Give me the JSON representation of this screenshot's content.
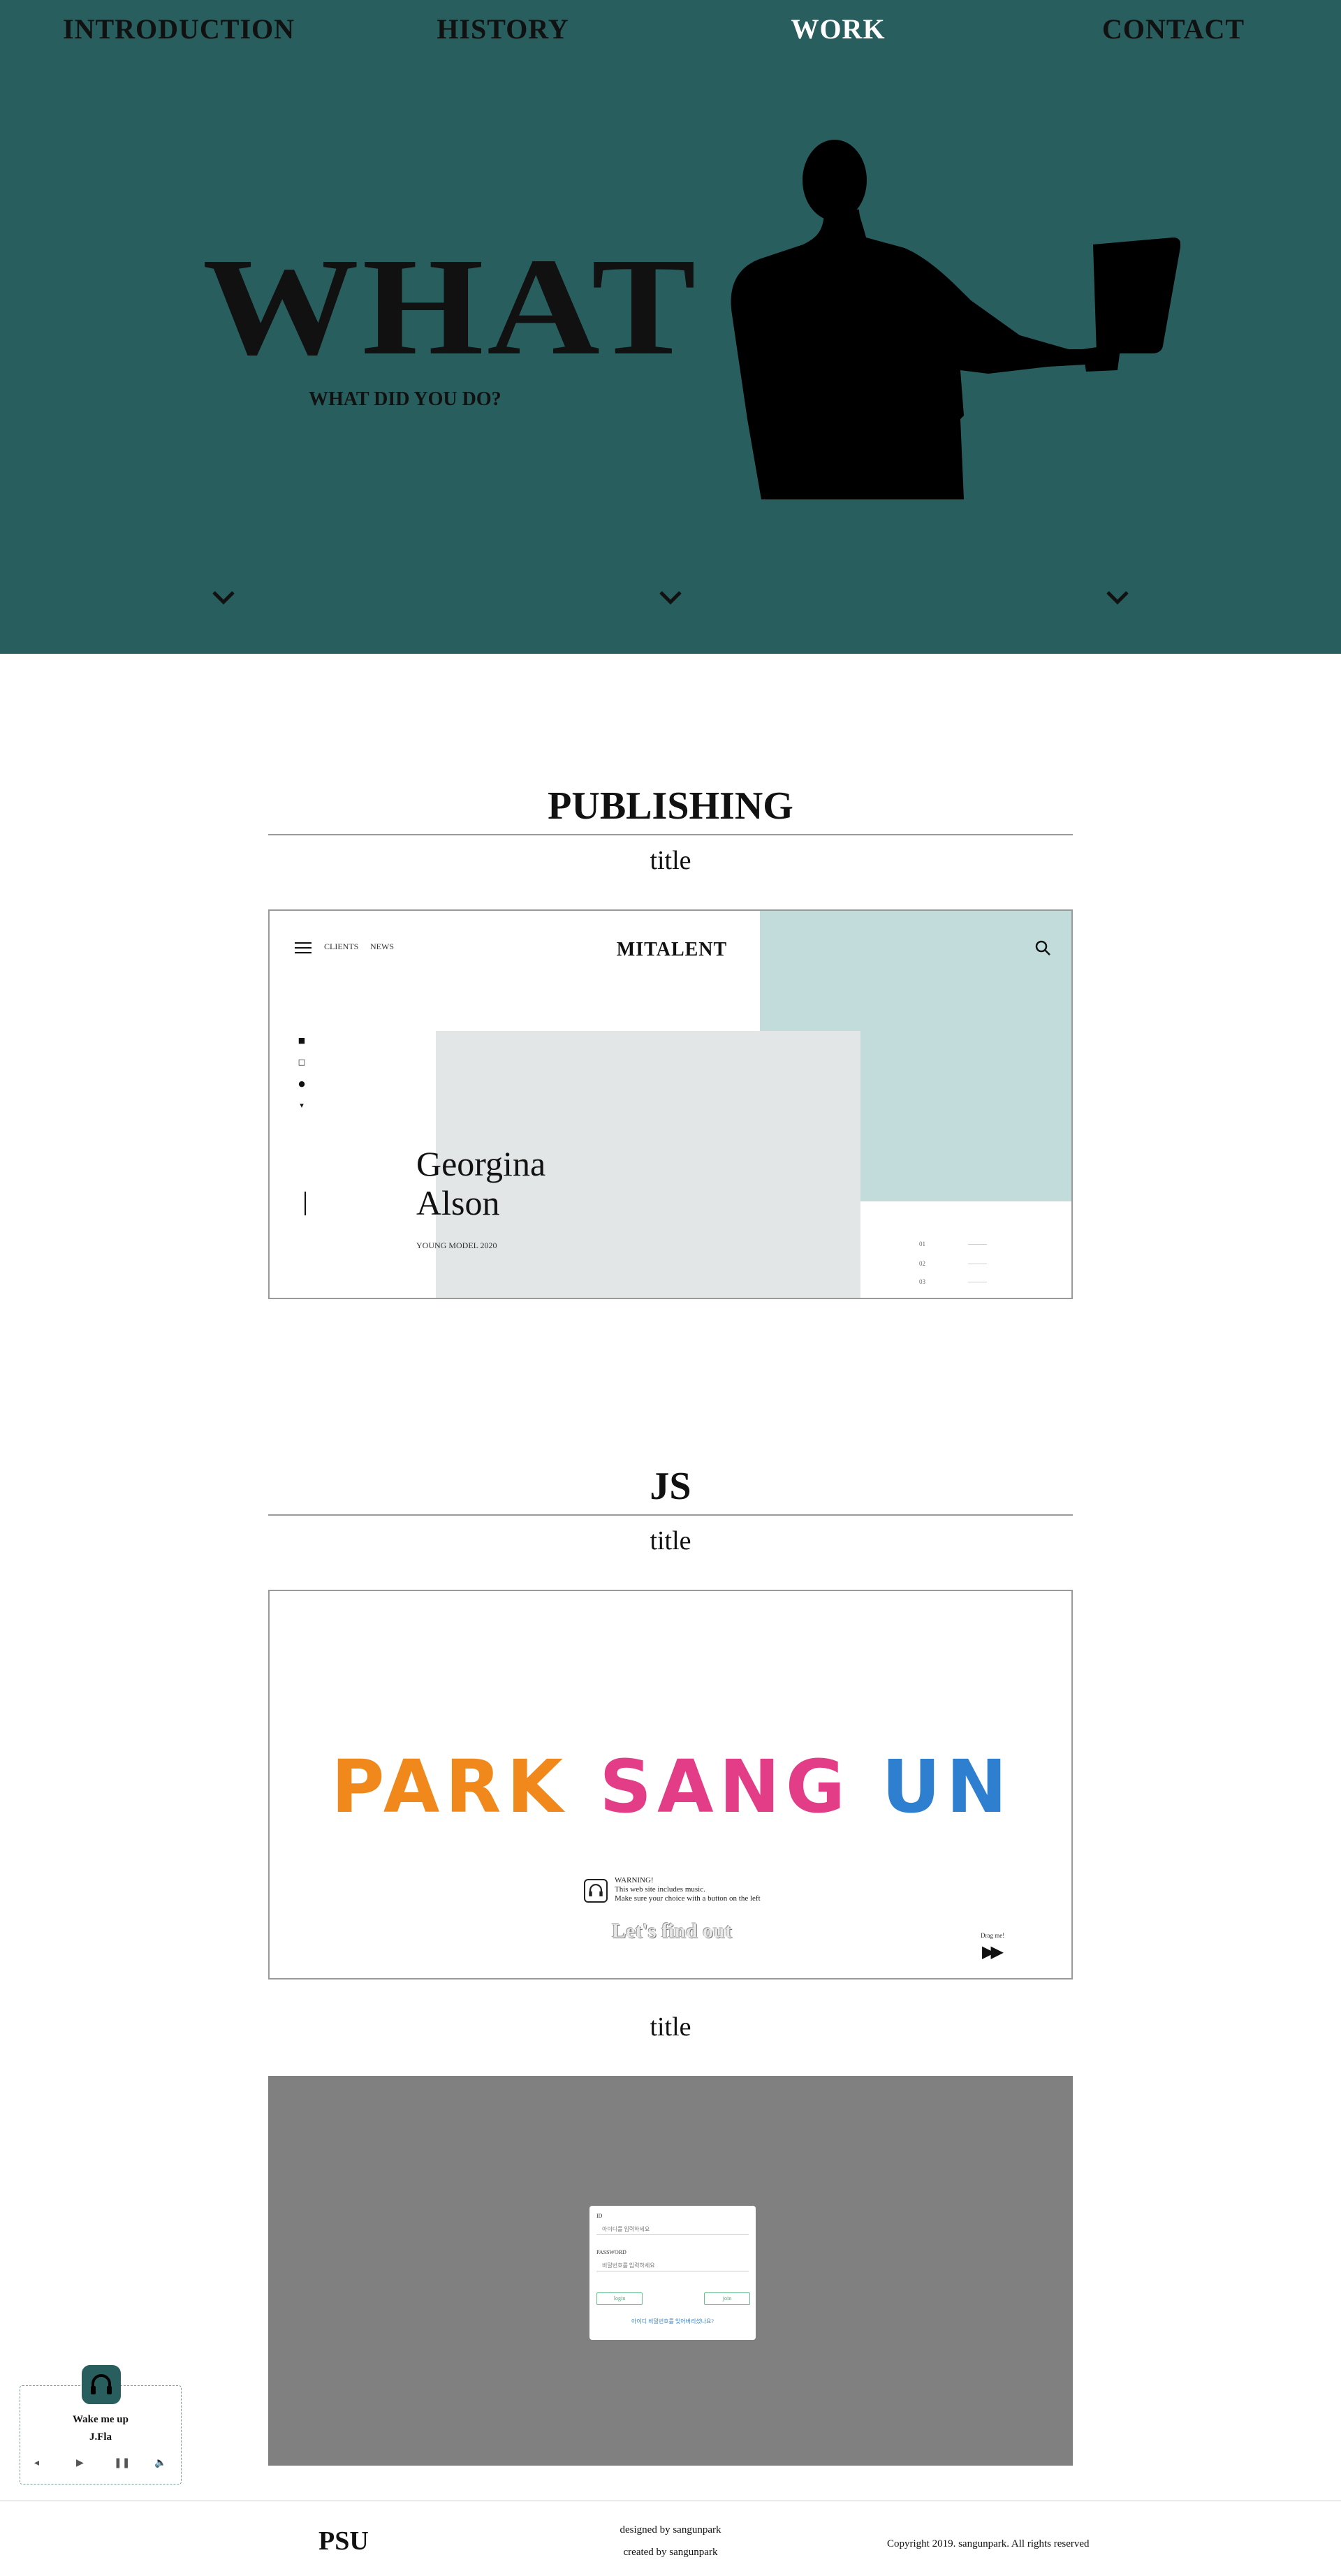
{
  "nav": {
    "items": [
      {
        "label": "INTRODUCTION",
        "active": false
      },
      {
        "label": "HISTORY",
        "active": false
      },
      {
        "label": "WORK",
        "active": true
      },
      {
        "label": "CONTACT",
        "active": false
      }
    ]
  },
  "hero": {
    "title": "WHAT",
    "subtitle": "WHAT DID YOU DO?",
    "background": "#295e5f"
  },
  "sections": {
    "publishing": {
      "heading": "PUBLISHING",
      "item_title": "title",
      "preview": {
        "links": [
          "CLIENTS",
          "NEWS"
        ],
        "logo": "MITALENT",
        "name_line1": "Georgina",
        "name_line2": "Alson",
        "role": "YOUNG MODEL 2020",
        "numbers": [
          "01",
          "02",
          "03"
        ],
        "dashes": [
          "———",
          "———",
          "———"
        ],
        "social_icons": [
          "facebook-icon",
          "instagram-icon",
          "youtube-icon",
          "twitter-icon"
        ]
      }
    },
    "js": {
      "heading": "JS",
      "item_title": "title",
      "preview": {
        "word1": "PARK",
        "word2": "SANG",
        "word3": "UN",
        "warning_title": "WARNING!",
        "warning_line1": "This web site includes music.",
        "warning_line2": "Make sure your choice with a button on the left",
        "cta": "Let's find out",
        "drag": "Drag me!"
      }
    },
    "login": {
      "item_title": "title",
      "preview": {
        "id_label": "ID",
        "id_placeholder": "아이디를 입력하세요",
        "pw_label": "PASSWORD",
        "pw_placeholder": "비밀번호를 입력하세요",
        "login_button": "login",
        "join_button": "join",
        "find_link": "아이디 비밀번호를 잊어버리셨나요?"
      }
    }
  },
  "player": {
    "song": "Wake me up",
    "artist": "J.Fla",
    "accent": "#295e5f"
  },
  "footer": {
    "logo": "PSU",
    "designed": "designed by sangunpark",
    "created": "created by sangunpark",
    "copyright": "Copyright 2019. sangunpark. All rights reserved"
  }
}
